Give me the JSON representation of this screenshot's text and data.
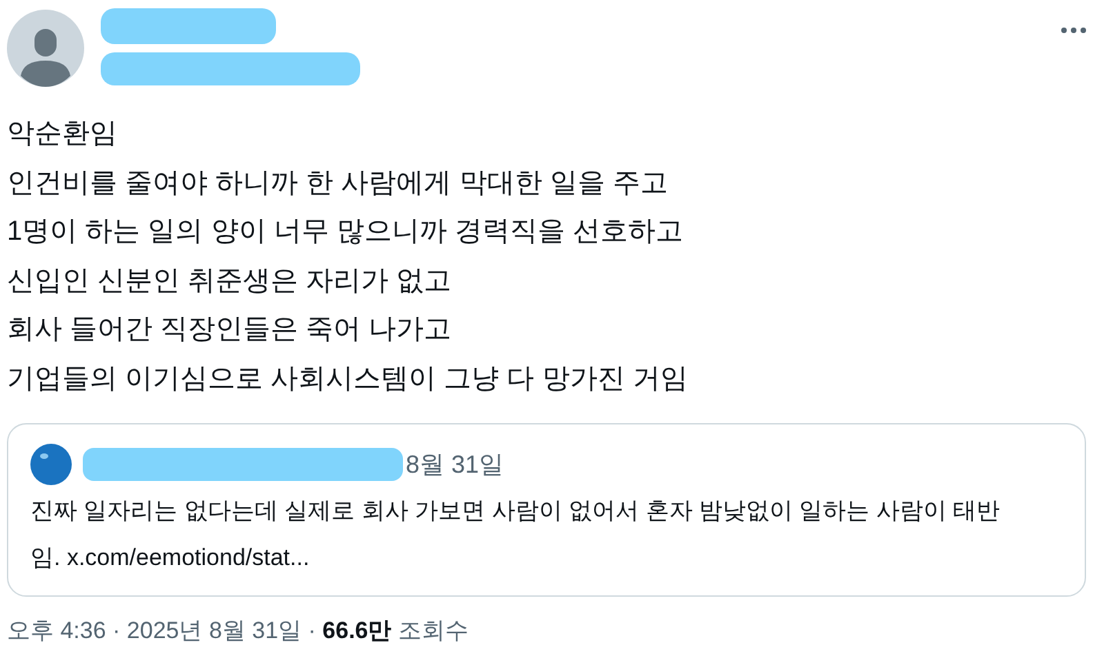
{
  "body_lines": [
    "악순환임",
    "인건비를 줄여야 하니까 한 사람에게 막대한 일을 주고",
    "1명이 하는 일의 양이 너무 많으니까 경력직을 선호하고",
    "신입인 신분인 취준생은 자리가 없고",
    "회사 들어간 직장인들은 죽어 나가고",
    "기업들의 이기심으로 사회시스템이 그냥 다 망가진 거임"
  ],
  "quote": {
    "date": "8월 31일",
    "text": "진짜 일자리는 없다는데 실제로 회사 가보면 사람이 없어서 혼자 밤낮없이 일하는 사람이 태반임. x.com/eemotiond/stat..."
  },
  "footer": "오후 4:36 · 2025년 8월 31일 · **66.6만** 조회수"
}
